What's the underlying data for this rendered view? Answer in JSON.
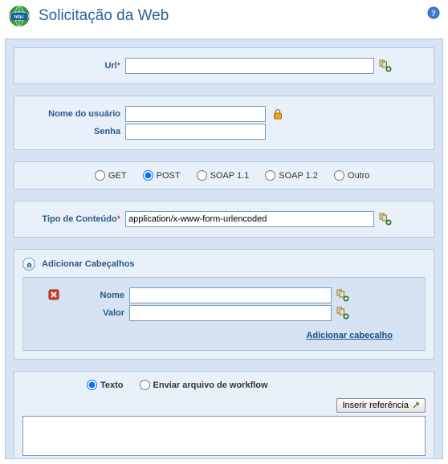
{
  "header": {
    "title": "Solicitação da Web"
  },
  "url": {
    "label": "Url",
    "value": ""
  },
  "credentials": {
    "username_label": "Nome do usuário",
    "username_value": "",
    "password_label": "Senha",
    "password_value": ""
  },
  "methods": {
    "selected": "POST",
    "options": {
      "get": "GET",
      "post": "POST",
      "soap11": "SOAP 1.1",
      "soap12": "SOAP 1.2",
      "other": "Outro"
    }
  },
  "content_type": {
    "label": "Tipo de Conteúdo",
    "value": "application/x-www-form-urlencoded"
  },
  "headers_section": {
    "title": "Adicionar Cabeçalhos",
    "name_label": "Nome",
    "value_label": "Valor",
    "name_value": "",
    "value_value": "",
    "add_link": "Adicionar cabeçalho"
  },
  "body_section": {
    "text_label": "Texto",
    "file_label": "Enviar arquivo de workflow",
    "selected": "Texto",
    "insert_ref_label": "Inserir referência",
    "body_value": ""
  }
}
